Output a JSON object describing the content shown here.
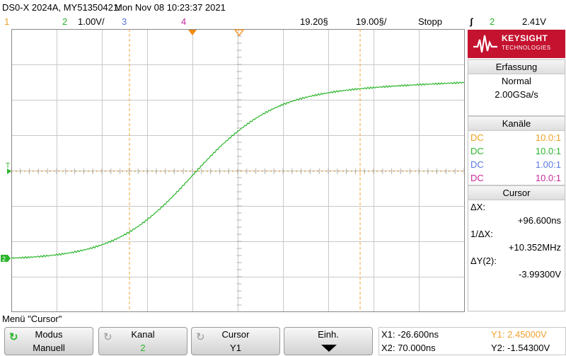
{
  "title": {
    "device": "DS0-X 2024A, MY51350421:",
    "datetime": "Mon Nov 08 10:23:37 2021"
  },
  "status": {
    "ch1": "1",
    "ch2": "2",
    "ch2_scale": "1.00V/",
    "ch3": "3",
    "ch4": "4",
    "timebase_delay": "19.20§",
    "timebase_scale": "19.00§/",
    "run_state": "Stopp",
    "trigger_icon": "ʃ",
    "trigger_channel": "2",
    "trigger_level": "2.41V"
  },
  "colors": {
    "ch1": "#e8a020",
    "ch2": "#2bb52b",
    "ch3": "#5a78e0",
    "ch4": "#c8299a",
    "cursor": "#f0a030",
    "logo_bg": "#c4122f"
  },
  "waveform_markers": {
    "ch2_ground_label": "2",
    "trigger_level_label": "T"
  },
  "logo": {
    "name": "KEYSIGHT",
    "sub": "TECHNOLOGIES"
  },
  "acquisition": {
    "header": "Erfassung",
    "mode": "Normal",
    "rate": "2.00GSa/s"
  },
  "channels": {
    "header": "Kanäle",
    "rows": [
      {
        "coupling": "DC",
        "probe": "10.0:1"
      },
      {
        "coupling": "DC",
        "probe": "10.0:1"
      },
      {
        "coupling": "DC",
        "probe": "1.00:1"
      },
      {
        "coupling": "DC",
        "probe": "10.0:1"
      }
    ]
  },
  "cursor_panel": {
    "header": "Cursor",
    "dx_label": "ΔX:",
    "dx_value": "+96.600ns",
    "inv_dx_label": "1/ΔX:",
    "inv_dx_value": "+10.352MHz",
    "dy_label": "ΔY(2):",
    "dy_value": "-3.99300V"
  },
  "menu": {
    "title": "Menü \"Cursor\"",
    "softkeys": [
      {
        "top": "Modus",
        "bottom": "Manuell"
      },
      {
        "top": "Kanal",
        "bottom": "2"
      },
      {
        "top": "Cursor",
        "bottom": "Y1"
      },
      {
        "top": "Einh.",
        "bottom": ""
      }
    ]
  },
  "readout": {
    "x1": "X1: -26.600ns",
    "x2": "X2: 70.000ns",
    "y1": "Y1: 2.45000V",
    "y2": "Y2: -1.54300V"
  }
}
